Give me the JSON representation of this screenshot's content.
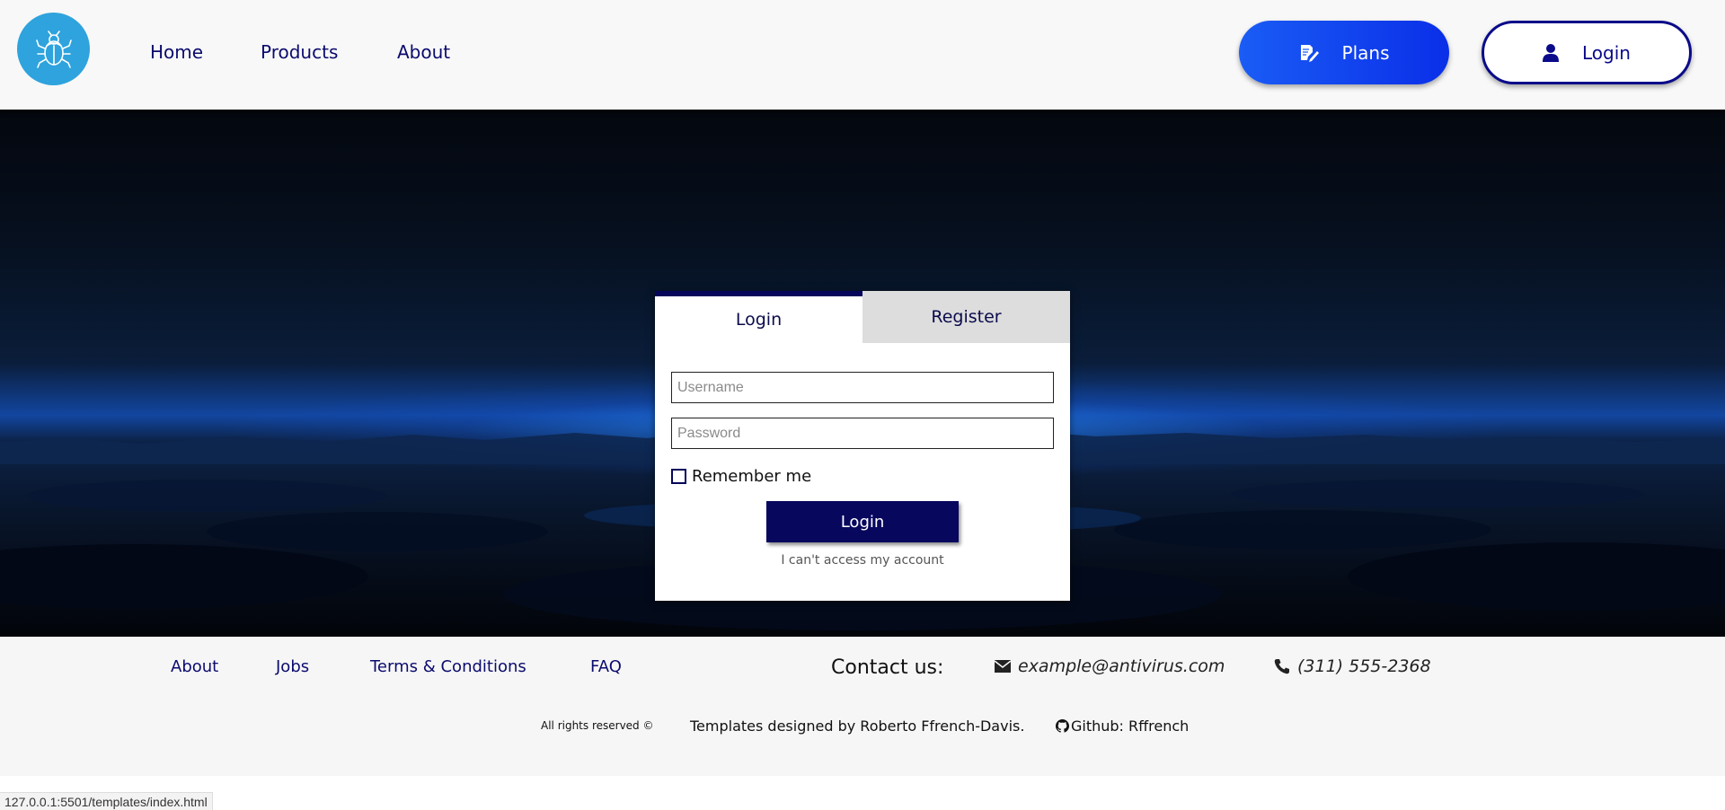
{
  "header": {
    "logo": "bug-icon",
    "nav": [
      "Home",
      "Products",
      "About"
    ],
    "plans_label": "Plans",
    "login_label": "Login"
  },
  "login_card": {
    "tabs": [
      "Login",
      "Register"
    ],
    "active_tab": "Login",
    "username_placeholder": "Username",
    "password_placeholder": "Password",
    "username_value": "",
    "password_value": "",
    "remember_label": "Remember me",
    "remember_checked": false,
    "submit_label": "Login",
    "forgot_label": "I can't access my account"
  },
  "footer": {
    "links": [
      "About",
      "Jobs",
      "Terms & Conditions",
      "FAQ"
    ],
    "contact_title": "Contact us:",
    "email": "example@antivirus.com",
    "phone": "(311) 555-2368",
    "rights": "All rights reserved ©",
    "designed_by": "Templates designed by Roberto Ffrench-Davis.",
    "github": "Github: Rffrench"
  },
  "status_bar": {
    "url": "127.0.0.1:5501/templates/index.html"
  },
  "colors": {
    "primary_navy": "#07075e",
    "accent_blue": "#1a5cf5",
    "logo_blue": "#2ea3dd",
    "header_bg": "#f8f8f8",
    "footer_bg": "#f6f6f6"
  }
}
